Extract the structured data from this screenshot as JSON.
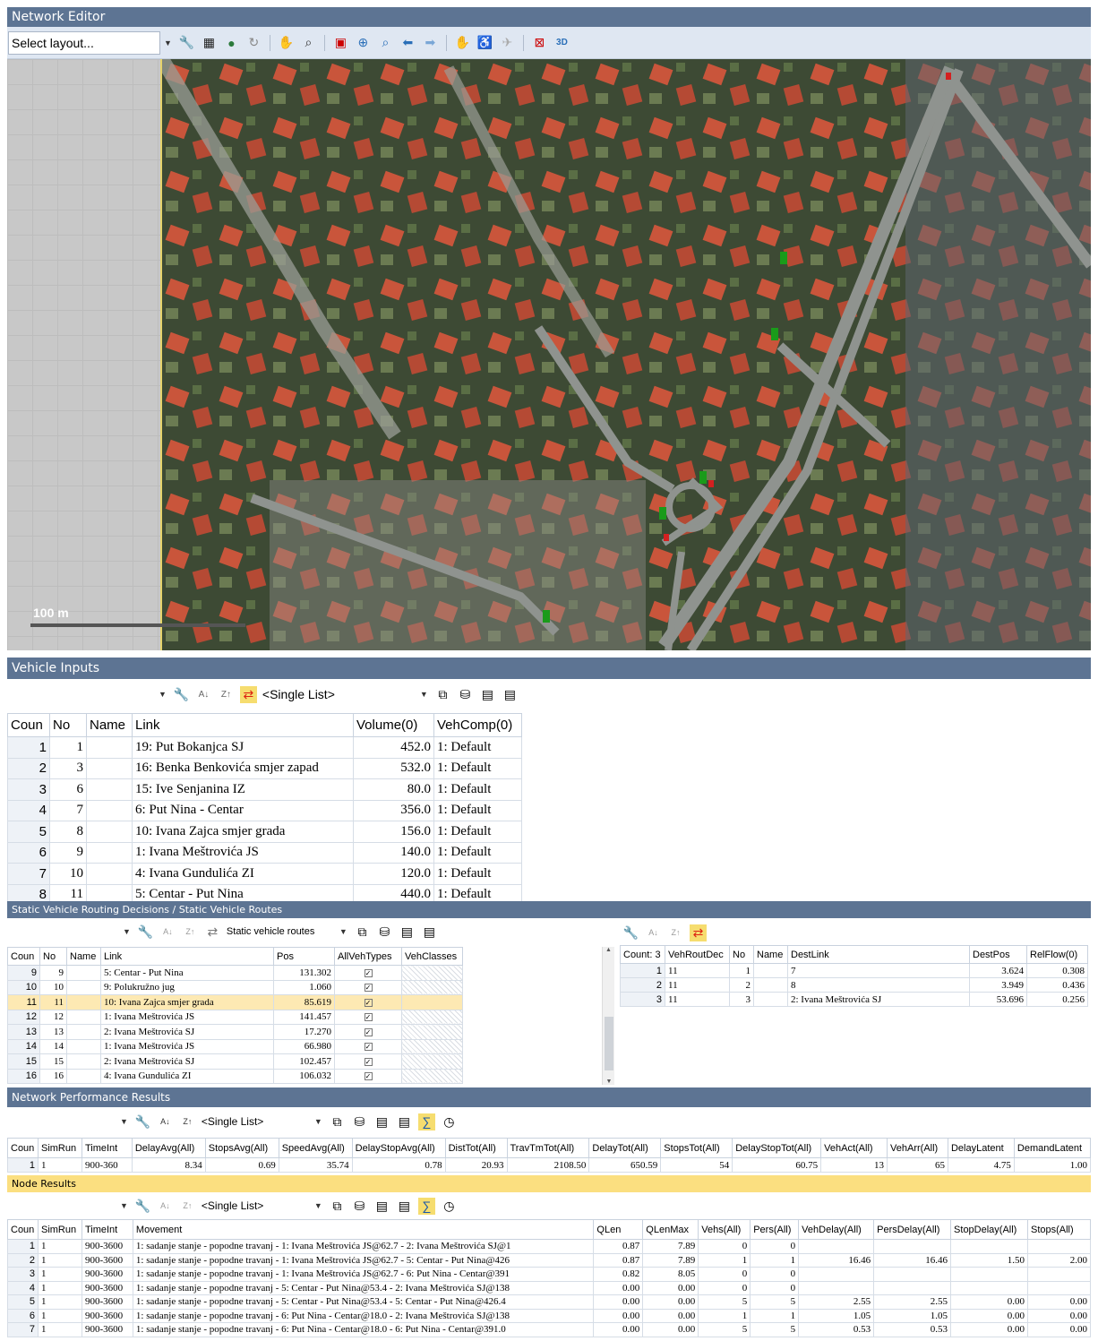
{
  "network_editor": {
    "title": "Network Editor",
    "layout_select": "Select layout...",
    "scale_label": "100 m"
  },
  "vehicle_inputs": {
    "title": "Vehicle Inputs",
    "list_select": "<Single List>",
    "columns": [
      "Coun",
      "No",
      "Name",
      "Link",
      "Volume(0)",
      "VehComp(0)"
    ],
    "rows": [
      [
        "1",
        "1",
        "",
        "19: Put Bokanjca SJ",
        "452.0",
        "1: Default"
      ],
      [
        "2",
        "3",
        "",
        "16: Benka Benkovića smjer zapad",
        "532.0",
        "1: Default"
      ],
      [
        "3",
        "6",
        "",
        "15: Ive Senjanina IZ",
        "80.0",
        "1: Default"
      ],
      [
        "4",
        "7",
        "",
        "6: Put Nina - Centar",
        "356.0",
        "1: Default"
      ],
      [
        "5",
        "8",
        "",
        "10: Ivana Zajca smjer grada",
        "156.0",
        "1: Default"
      ],
      [
        "6",
        "9",
        "",
        "1: Ivana Meštrovića JS",
        "140.0",
        "1: Default"
      ],
      [
        "7",
        "10",
        "",
        "4: Ivana Gundulića ZI",
        "120.0",
        "1: Default"
      ],
      [
        "8",
        "11",
        "",
        "5: Centar - Put Nina",
        "440.0",
        "1: Default"
      ]
    ]
  },
  "routing": {
    "title": "Static Vehicle Routing Decisions / Static Vehicle Routes",
    "list_select": "Static vehicle routes",
    "columns": [
      "Coun",
      "No",
      "Name",
      "Link",
      "Pos",
      "AllVehTypes",
      "VehClasses"
    ],
    "rows": [
      [
        "9",
        "9",
        "",
        "5: Centar - Put Nina",
        "131.302"
      ],
      [
        "10",
        "10",
        "",
        "9: Polukružno jug",
        "1.060"
      ],
      [
        "11",
        "11",
        "",
        "10: Ivana Zajca smjer grada",
        "85.619"
      ],
      [
        "12",
        "12",
        "",
        "1: Ivana Meštrovića JS",
        "141.457"
      ],
      [
        "13",
        "13",
        "",
        "2: Ivana Meštrovića SJ",
        "17.270"
      ],
      [
        "14",
        "14",
        "",
        "1: Ivana Meštrovića JS",
        "66.980"
      ],
      [
        "15",
        "15",
        "",
        "2: Ivana Meštrovića SJ",
        "102.457"
      ],
      [
        "16",
        "16",
        "",
        "4: Ivana Gundulića ZI",
        "106.032"
      ]
    ],
    "routes_columns": [
      "Count: 3",
      "VehRoutDec",
      "No",
      "Name",
      "DestLink",
      "DestPos",
      "RelFlow(0)"
    ],
    "routes_rows": [
      [
        "1",
        "11",
        "1",
        "",
        "7",
        "3.624",
        "0.308"
      ],
      [
        "2",
        "11",
        "2",
        "",
        "8",
        "3.949",
        "0.436"
      ],
      [
        "3",
        "11",
        "3",
        "",
        "2: Ivana Meštrovića SJ",
        "53.696",
        "0.256"
      ]
    ]
  },
  "network_performance": {
    "title": "Network Performance Results",
    "list_select": "<Single List>",
    "columns": [
      "Coun",
      "SimRun",
      "TimeInt",
      "DelayAvg(All)",
      "StopsAvg(All)",
      "SpeedAvg(All)",
      "DelayStopAvg(All)",
      "DistTot(All)",
      "TravTmTot(All)",
      "DelayTot(All)",
      "StopsTot(All)",
      "DelayStopTot(All)",
      "VehAct(All)",
      "VehArr(All)",
      "DelayLatent",
      "DemandLatent"
    ],
    "rows": [
      [
        "1",
        "1",
        "900-360",
        "8.34",
        "0.69",
        "35.74",
        "0.78",
        "20.93",
        "2108.50",
        "650.59",
        "54",
        "60.75",
        "13",
        "65",
        "4.75",
        "1.00"
      ]
    ]
  },
  "node_results": {
    "title": "Node Results",
    "list_select": "<Single List>",
    "columns": [
      "Coun",
      "SimRun",
      "TimeInt",
      "Movement",
      "QLen",
      "QLenMax",
      "Vehs(All)",
      "Pers(All)",
      "VehDelay(All)",
      "PersDelay(All)",
      "StopDelay(All)",
      "Stops(All)"
    ],
    "rows": [
      [
        "1",
        "1",
        "900-3600",
        "1: sadanje stanje - popodne travanj - 1: Ivana Meštrovića JS@62.7 - 2: Ivana Meštrovića SJ@1",
        "0.87",
        "7.89",
        "0",
        "0",
        "",
        "",
        "",
        ""
      ],
      [
        "2",
        "1",
        "900-3600",
        "1: sadanje stanje - popodne travanj - 1: Ivana Meštrovića JS@62.7 - 5: Centar - Put Nina@426",
        "0.87",
        "7.89",
        "1",
        "1",
        "16.46",
        "16.46",
        "1.50",
        "2.00"
      ],
      [
        "3",
        "1",
        "900-3600",
        "1: sadanje stanje - popodne travanj - 1: Ivana Meštrovića JS@62.7 - 6: Put Nina - Centar@391",
        "0.82",
        "8.05",
        "0",
        "0",
        "",
        "",
        "",
        ""
      ],
      [
        "4",
        "1",
        "900-3600",
        "1: sadanje stanje - popodne travanj - 5: Centar - Put Nina@53.4 - 2: Ivana Meštrovića SJ@138",
        "0.00",
        "0.00",
        "0",
        "0",
        "",
        "",
        "",
        ""
      ],
      [
        "5",
        "1",
        "900-3600",
        "1: sadanje stanje - popodne travanj - 5: Centar - Put Nina@53.4 - 5: Centar - Put Nina@426.4",
        "0.00",
        "0.00",
        "5",
        "5",
        "2.55",
        "2.55",
        "0.00",
        "0.00"
      ],
      [
        "6",
        "1",
        "900-3600",
        "1: sadanje stanje - popodne travanj - 6: Put Nina - Centar@18.0 - 2: Ivana Meštrovića SJ@138",
        "0.00",
        "0.00",
        "1",
        "1",
        "1.05",
        "1.05",
        "0.00",
        "0.00"
      ],
      [
        "7",
        "1",
        "900-3600",
        "1: sadanje stanje - popodne travanj - 6: Put Nina - Centar@18.0 - 6: Put Nina - Centar@391.0",
        "0.00",
        "0.00",
        "5",
        "5",
        "0.53",
        "0.53",
        "0.00",
        "0.00"
      ]
    ]
  }
}
